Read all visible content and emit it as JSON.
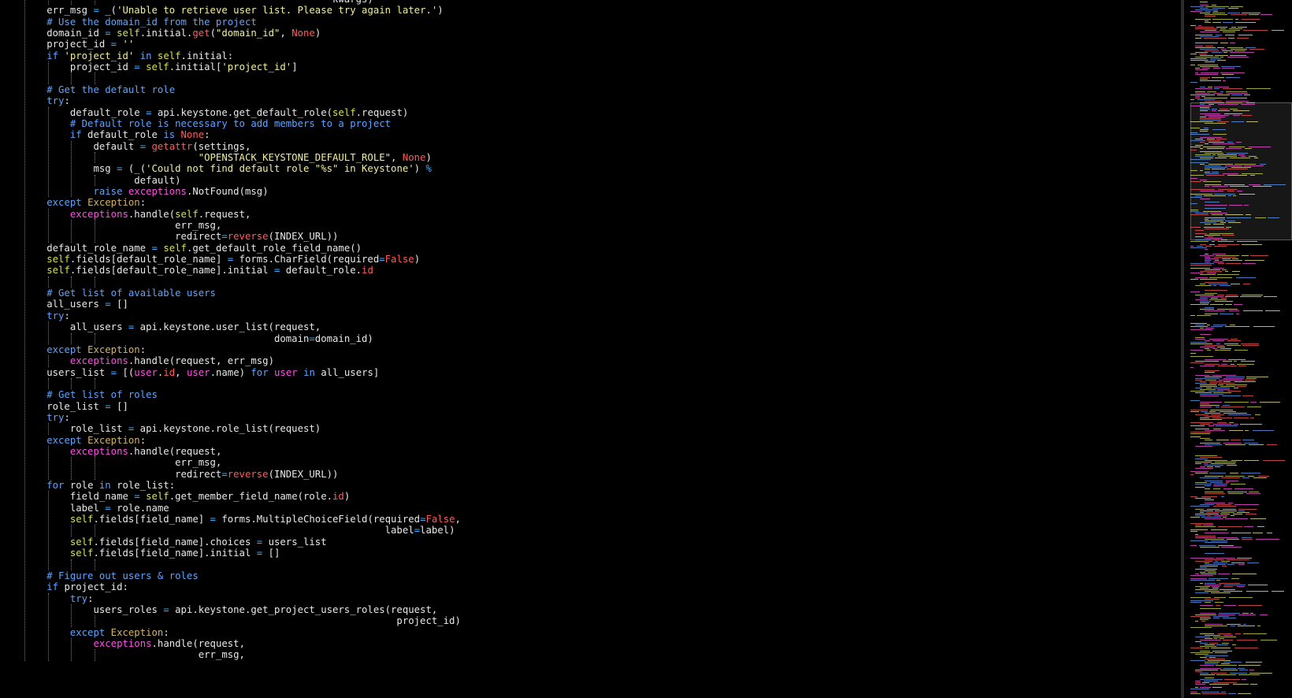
{
  "editor": {
    "lines": [
      [
        [
          "                                                       "
        ],
        [
          "**",
          "o"
        ],
        [
          "kwargs)"
        ]
      ],
      [
        [
          "        err_msg "
        ],
        [
          "=",
          "o"
        ],
        [
          " _("
        ],
        [
          "'Unable to retrieve user list. Please try again later.'",
          "s"
        ],
        [
          ")"
        ]
      ],
      [
        [
          "        "
        ],
        [
          "# Use the domain_id from the project",
          "c"
        ]
      ],
      [
        [
          "        domain_id "
        ],
        [
          "=",
          "o"
        ],
        [
          " "
        ],
        [
          "self",
          "self"
        ],
        [
          ".initial."
        ],
        [
          "get",
          "f"
        ],
        [
          "("
        ],
        [
          "\"domain_id\"",
          "s"
        ],
        [
          ", "
        ],
        [
          "None",
          "n"
        ],
        [
          ")"
        ]
      ],
      [
        [
          "        project_id "
        ],
        [
          "=",
          "o"
        ],
        [
          " "
        ],
        [
          "''",
          "s"
        ]
      ],
      [
        [
          "        "
        ],
        [
          "if",
          "k"
        ],
        [
          " "
        ],
        [
          "'project_id'",
          "s"
        ],
        [
          " "
        ],
        [
          "in",
          "k"
        ],
        [
          " "
        ],
        [
          "self",
          "self"
        ],
        [
          ".initial:"
        ]
      ],
      [
        [
          "            project_id "
        ],
        [
          "=",
          "o"
        ],
        [
          " "
        ],
        [
          "self",
          "self"
        ],
        [
          ".initial["
        ],
        [
          "'project_id'",
          "s"
        ],
        [
          "]"
        ]
      ],
      [
        [
          ""
        ]
      ],
      [
        [
          "        "
        ],
        [
          "# Get the default role",
          "c"
        ]
      ],
      [
        [
          "        "
        ],
        [
          "try",
          "k"
        ],
        [
          ":"
        ]
      ],
      [
        [
          "            default_role "
        ],
        [
          "=",
          "o"
        ],
        [
          " api.keystone.get_default_role("
        ],
        [
          "self",
          "self"
        ],
        [
          ".request)"
        ]
      ],
      [
        [
          "            "
        ],
        [
          "# Default role is necessary to add members to a project",
          "c"
        ]
      ],
      [
        [
          "            "
        ],
        [
          "if",
          "k"
        ],
        [
          " default_role "
        ],
        [
          "is",
          "k"
        ],
        [
          " "
        ],
        [
          "None",
          "n"
        ],
        [
          ":"
        ]
      ],
      [
        [
          "                default "
        ],
        [
          "=",
          "o"
        ],
        [
          " "
        ],
        [
          "getattr",
          "f"
        ],
        [
          "(settings,"
        ]
      ],
      [
        [
          "                                  "
        ],
        [
          "\"OPENSTACK_KEYSTONE_DEFAULT_ROLE\"",
          "s"
        ],
        [
          ", "
        ],
        [
          "None",
          "n"
        ],
        [
          ")"
        ]
      ],
      [
        [
          "                msg "
        ],
        [
          "=",
          "o"
        ],
        [
          " (_("
        ],
        [
          "'Could not find default role \"%s\" in Keystone'",
          "s"
        ],
        [
          ") "
        ],
        [
          "%",
          "o"
        ]
      ],
      [
        [
          "                       default)"
        ]
      ],
      [
        [
          "                "
        ],
        [
          "raise",
          "k"
        ],
        [
          " "
        ],
        [
          "exceptions",
          "m"
        ],
        [
          ".NotFound(msg)"
        ]
      ],
      [
        [
          "        "
        ],
        [
          "except",
          "k"
        ],
        [
          " "
        ],
        [
          "Exception",
          "e"
        ],
        [
          ":"
        ]
      ],
      [
        [
          "            "
        ],
        [
          "exceptions",
          "m"
        ],
        [
          ".handle("
        ],
        [
          "self",
          "self"
        ],
        [
          ".request,"
        ]
      ],
      [
        [
          "                              err_msg,"
        ]
      ],
      [
        [
          "                              redirect"
        ],
        [
          "=",
          "o"
        ],
        [
          "reverse",
          "f"
        ],
        [
          "(INDEX_URL))"
        ]
      ],
      [
        [
          "        default_role_name "
        ],
        [
          "=",
          "o"
        ],
        [
          " "
        ],
        [
          "self",
          "self"
        ],
        [
          ".get_default_role_field_name()"
        ]
      ],
      [
        [
          "        "
        ],
        [
          "self",
          "self"
        ],
        [
          ".fields[default_role_name] "
        ],
        [
          "=",
          "o"
        ],
        [
          " forms.CharField(required"
        ],
        [
          "=",
          "o"
        ],
        [
          "False",
          "n"
        ],
        [
          ")"
        ]
      ],
      [
        [
          "        "
        ],
        [
          "self",
          "self"
        ],
        [
          ".fields[default_role_name].initial "
        ],
        [
          "=",
          "o"
        ],
        [
          " default_role."
        ],
        [
          "id",
          "n"
        ]
      ],
      [
        [
          ""
        ]
      ],
      [
        [
          "        "
        ],
        [
          "# Get list of available users",
          "c"
        ]
      ],
      [
        [
          "        all_users "
        ],
        [
          "=",
          "o"
        ],
        [
          " []"
        ]
      ],
      [
        [
          "        "
        ],
        [
          "try",
          "k"
        ],
        [
          ":"
        ]
      ],
      [
        [
          "            all_users "
        ],
        [
          "=",
          "o"
        ],
        [
          " api.keystone.user_list(request,"
        ]
      ],
      [
        [
          "                                               domain"
        ],
        [
          "=",
          "o"
        ],
        [
          "domain_id)"
        ]
      ],
      [
        [
          "        "
        ],
        [
          "except",
          "k"
        ],
        [
          " "
        ],
        [
          "Exception",
          "e"
        ],
        [
          ":"
        ]
      ],
      [
        [
          "            "
        ],
        [
          "exceptions",
          "m"
        ],
        [
          ".handle(request, err_msg)"
        ]
      ],
      [
        [
          "        users_list "
        ],
        [
          "=",
          "o"
        ],
        [
          " [("
        ],
        [
          "user",
          "m"
        ],
        [
          "."
        ],
        [
          "id",
          "n"
        ],
        [
          ", "
        ],
        [
          "user",
          "m"
        ],
        [
          ".name) "
        ],
        [
          "for",
          "k"
        ],
        [
          " "
        ],
        [
          "user",
          "m"
        ],
        [
          " "
        ],
        [
          "in",
          "k"
        ],
        [
          " all_users]"
        ]
      ],
      [
        [
          ""
        ]
      ],
      [
        [
          "        "
        ],
        [
          "# Get list of roles",
          "c"
        ]
      ],
      [
        [
          "        role_list "
        ],
        [
          "=",
          "o"
        ],
        [
          " []"
        ]
      ],
      [
        [
          "        "
        ],
        [
          "try",
          "k"
        ],
        [
          ":"
        ]
      ],
      [
        [
          "            role_list "
        ],
        [
          "=",
          "o"
        ],
        [
          " api.keystone.role_list(request)"
        ]
      ],
      [
        [
          "        "
        ],
        [
          "except",
          "k"
        ],
        [
          " "
        ],
        [
          "Exception",
          "e"
        ],
        [
          ":"
        ]
      ],
      [
        [
          "            "
        ],
        [
          "exceptions",
          "m"
        ],
        [
          ".handle(request,"
        ]
      ],
      [
        [
          "                              err_msg,"
        ]
      ],
      [
        [
          "                              redirect"
        ],
        [
          "=",
          "o"
        ],
        [
          "reverse",
          "f"
        ],
        [
          "(INDEX_URL))"
        ]
      ],
      [
        [
          "        "
        ],
        [
          "for",
          "k"
        ],
        [
          " role "
        ],
        [
          "in",
          "k"
        ],
        [
          " role_list:"
        ]
      ],
      [
        [
          "            field_name "
        ],
        [
          "=",
          "o"
        ],
        [
          " "
        ],
        [
          "self",
          "self"
        ],
        [
          ".get_member_field_name(role."
        ],
        [
          "id",
          "n"
        ],
        [
          ")"
        ]
      ],
      [
        [
          "            label "
        ],
        [
          "=",
          "o"
        ],
        [
          " role.name"
        ]
      ],
      [
        [
          "            "
        ],
        [
          "self",
          "self"
        ],
        [
          ".fields[field_name] "
        ],
        [
          "=",
          "o"
        ],
        [
          " forms.MultipleChoiceField(required"
        ],
        [
          "=",
          "o"
        ],
        [
          "False",
          "n"
        ],
        [
          ","
        ]
      ],
      [
        [
          "                                                                  label"
        ],
        [
          "=",
          "o"
        ],
        [
          "label)"
        ]
      ],
      [
        [
          "            "
        ],
        [
          "self",
          "self"
        ],
        [
          ".fields[field_name].choices "
        ],
        [
          "=",
          "o"
        ],
        [
          " users_list"
        ]
      ],
      [
        [
          "            "
        ],
        [
          "self",
          "self"
        ],
        [
          ".fields[field_name].initial "
        ],
        [
          "=",
          "o"
        ],
        [
          " []"
        ]
      ],
      [
        [
          ""
        ]
      ],
      [
        [
          "        "
        ],
        [
          "# Figure out users & roles",
          "c"
        ]
      ],
      [
        [
          "        "
        ],
        [
          "if",
          "k"
        ],
        [
          " project_id:"
        ]
      ],
      [
        [
          "            "
        ],
        [
          "try",
          "k"
        ],
        [
          ":"
        ]
      ],
      [
        [
          "                users_roles "
        ],
        [
          "=",
          "o"
        ],
        [
          " api.keystone.get_project_users_roles(request,"
        ]
      ],
      [
        [
          "                                                                    project_id)"
        ]
      ],
      [
        [
          "            "
        ],
        [
          "except",
          "k"
        ],
        [
          " "
        ],
        [
          "Exception",
          "e"
        ],
        [
          ":"
        ]
      ],
      [
        [
          "                "
        ],
        [
          "exceptions",
          "m"
        ],
        [
          ".handle(request,"
        ]
      ],
      [
        [
          "                                  err_msg,"
        ]
      ]
    ]
  }
}
